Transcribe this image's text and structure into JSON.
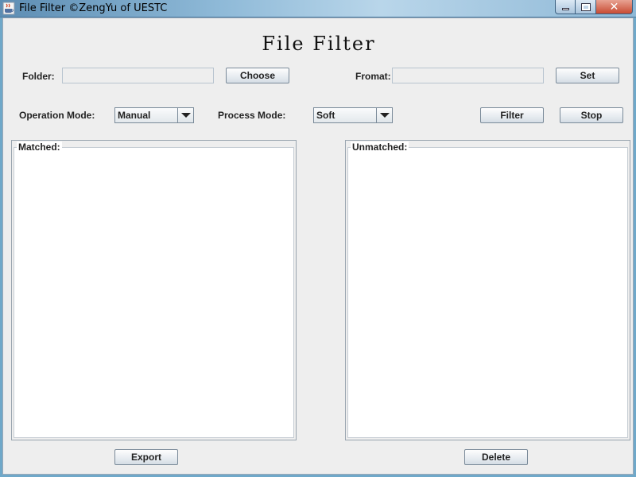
{
  "window": {
    "title": "File Filter ©ZengYu of UESTC",
    "icon": "java-cup-icon",
    "controls": {
      "minimize": "minimize-icon",
      "maximize": "maximize-icon",
      "close": "✕"
    }
  },
  "app": {
    "title": "File Filter"
  },
  "folder": {
    "label": "Folder:",
    "value": "",
    "choose_label": "Choose"
  },
  "format": {
    "label": "Fromat:",
    "value": "",
    "set_label": "Set"
  },
  "operation_mode": {
    "label": "Operation Mode:",
    "selected": "Manual"
  },
  "process_mode": {
    "label": "Process Mode:",
    "selected": "Soft"
  },
  "actions": {
    "filter_label": "Filter",
    "stop_label": "Stop"
  },
  "matched": {
    "title": "Matched:",
    "items": []
  },
  "unmatched": {
    "title": "Unmatched:",
    "items": []
  },
  "footer": {
    "export_label": "Export",
    "delete_label": "Delete"
  }
}
